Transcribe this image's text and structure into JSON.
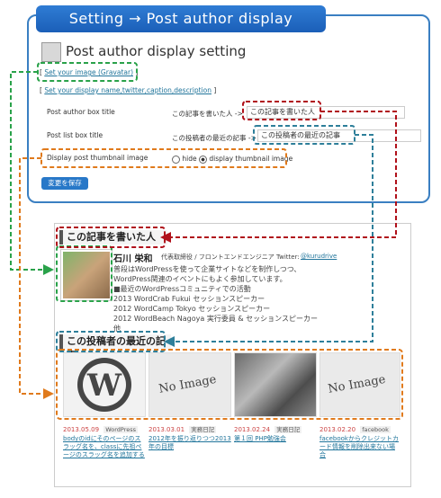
{
  "banner": {
    "title": "Setting → Post author display"
  },
  "admin": {
    "title": "Post author display setting",
    "gravatar_link": "Set your image (Gravatar)",
    "display_link": "Set your display name,twitter,caption,description",
    "rows": [
      {
        "label": "Post author box title",
        "prefix": "この記事を書いた人 ->",
        "value": "この記事を書いた人"
      },
      {
        "label": "Post list box title",
        "prefix": "この投稿者の最近の記事 ->",
        "value": "この投稿者の最近の記事"
      }
    ],
    "thumb_label": "Display post thumbnail image",
    "hide_label": "hide",
    "show_label": "display thumbnail image",
    "save_label": "変更を保存"
  },
  "preview": {
    "author_heading": "この記事を書いた人",
    "name": "石川 栄和",
    "role": "代表取締役 / フロントエンドエンジニア",
    "twitter_prefix": "Twitter:",
    "twitter": "@kurudrive",
    "bio": [
      "普段はWordPressを使って企業サイトなどを制作しつつ、",
      "WordPress関連のイベントにもよく参加しています。",
      "■最近のWordPressコミュニティでの活動",
      "2013 WordCrab Fukui セッションスピーカー",
      "2012 WordCamp Tokyo セッションスピーカー",
      "2012 WordBeach Nagoya 実行委員 & セッションスピーカー",
      "他"
    ],
    "recent_heading": "この投稿者の最近の記事",
    "no_image": "No Image",
    "posts": [
      {
        "date": "2013.05.09",
        "cat": "WordPress",
        "title": "bodyのidにそのページのスラッグ名を、classに先祖ページのスラッグ名を追加する"
      },
      {
        "date": "2013.03.01",
        "cat": "実務日記",
        "title": "2012年を振り返りつつ2013年の目標"
      },
      {
        "date": "2013.02.24",
        "cat": "実務日記",
        "title": "第１回 PHP勉強会"
      },
      {
        "date": "2013.02.20",
        "cat": "facebook",
        "title": "facebookからクレジットカード情報を削除出来ない場合"
      }
    ]
  },
  "colors": {
    "green": "#2aa24a",
    "red": "#b0101a",
    "teal": "#2e7f9a",
    "orange": "#e07a1c",
    "blue": "#3a7fc2"
  }
}
